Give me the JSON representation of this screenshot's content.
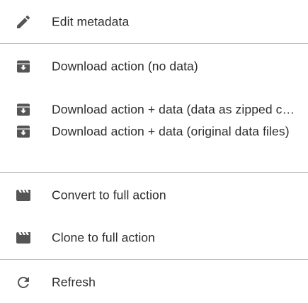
{
  "menu": {
    "items": [
      {
        "label": "Edit metadata",
        "icon": "pencil-icon"
      },
      {
        "label": "Download action (no data)",
        "icon": "archive-download-icon"
      },
      {
        "label": "Download action + data (data as zipped cs...",
        "icon": "archive-download-icon"
      },
      {
        "label": "Download action + data (original data files)",
        "icon": "archive-download-icon"
      },
      {
        "label": "Convert to full action",
        "icon": "clapperboard-icon"
      },
      {
        "label": "Clone to full action",
        "icon": "clapperboard-icon"
      },
      {
        "label": "Refresh",
        "icon": "refresh-icon"
      }
    ]
  },
  "colors": {
    "icon": "#555555",
    "text": "#2b2b2b",
    "divider": "#bdbdbd"
  }
}
